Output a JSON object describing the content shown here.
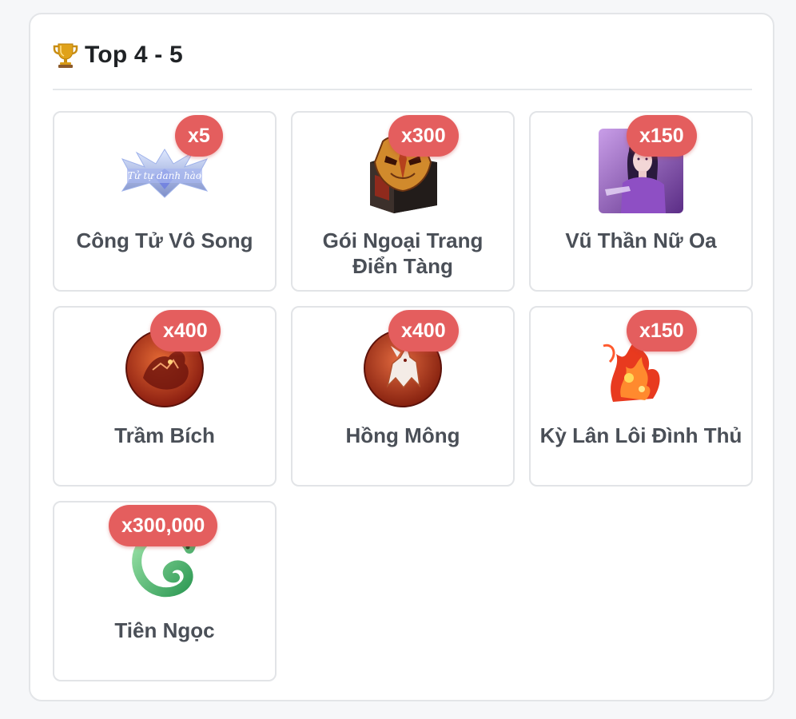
{
  "header": {
    "title": "Top 4 - 5",
    "icon": "trophy-icon"
  },
  "items": [
    {
      "name": "Công Tử Vô Song",
      "qty": "x5",
      "icon": "title-badge-image"
    },
    {
      "name": "Gói Ngoại Trang Điển Tàng",
      "qty": "x300",
      "icon": "mask-chest-image"
    },
    {
      "name": "Vũ Thần Nữ Oa",
      "qty": "x150",
      "icon": "goddess-portrait-image"
    },
    {
      "name": "Trầm Bích",
      "qty": "x400",
      "icon": "red-dragon-orb-image"
    },
    {
      "name": "Hồng Mông",
      "qty": "x400",
      "icon": "white-beast-orb-image"
    },
    {
      "name": "Kỳ Lân Lôi Đình Thủ",
      "qty": "x150",
      "icon": "fire-qilin-image"
    },
    {
      "name": "Tiên Ngọc",
      "qty": "x300,000",
      "icon": "jade-dragon-image"
    }
  ],
  "colors": {
    "badge": "#e45e5e",
    "card_border": "#e2e4e7",
    "text": "#4a4f57"
  }
}
